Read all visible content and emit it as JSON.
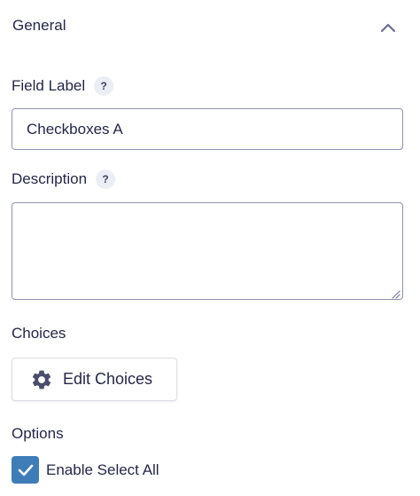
{
  "section": {
    "title": "General"
  },
  "field_label": {
    "label": "Field Label",
    "help": "?",
    "value": "Checkboxes A",
    "placeholder": ""
  },
  "description": {
    "label": "Description",
    "help": "?",
    "value": ""
  },
  "choices": {
    "label": "Choices",
    "button_label": "Edit Choices",
    "button_icon": "gear-icon"
  },
  "options": {
    "label": "Options",
    "enable_select_all": {
      "label": "Enable Select All",
      "checked": true
    }
  },
  "colors": {
    "text": "#242748",
    "checkbox_fill": "#3e7db8",
    "input_border": "#9092b2",
    "help_bg": "#eceef6"
  }
}
